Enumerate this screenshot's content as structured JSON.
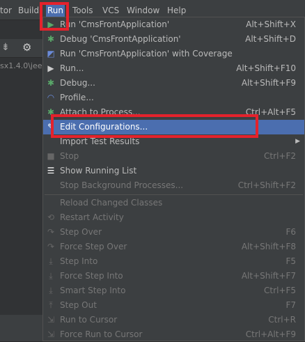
{
  "menubar": {
    "items": [
      "tor",
      "Build",
      "Run",
      "Tools",
      "VCS",
      "Window",
      "Help"
    ]
  },
  "left": {
    "path_text": "sx1.4.0\\jeec"
  },
  "run_menu": {
    "items": [
      {
        "label": "Run 'CmsFrontApplication'",
        "shortcut": "Alt+Shift+X",
        "icon": "run-icon"
      },
      {
        "label": "Debug 'CmsFrontApplication'",
        "shortcut": "Alt+Shift+D",
        "icon": "debug-icon"
      },
      {
        "label": "Run 'CmsFrontApplication' with Coverage",
        "shortcut": "",
        "icon": "coverage-icon"
      },
      {
        "label": "Run...",
        "shortcut": "Alt+Shift+F10",
        "icon": "run-triangle-icon"
      },
      {
        "label": "Debug...",
        "shortcut": "Alt+Shift+F9",
        "icon": "debug-icon"
      },
      {
        "label": "Profile...",
        "shortcut": "",
        "icon": "profile-icon"
      },
      {
        "label": "Attach to Process...",
        "shortcut": "Ctrl+Alt+F5",
        "icon": "attach-icon"
      },
      {
        "label": "Edit Configurations...",
        "shortcut": "",
        "icon": "edit-icon",
        "selected": true
      },
      {
        "label": "Import Test Results",
        "shortcut": "",
        "icon": "",
        "submenu": true
      },
      {
        "label": "Stop",
        "shortcut": "Ctrl+F2",
        "icon": "stop-icon",
        "disabled": true
      },
      {
        "label": "Show Running List",
        "shortcut": "",
        "icon": "list-icon"
      },
      {
        "label": "Stop Background Processes...",
        "shortcut": "Ctrl+Shift+F2",
        "icon": "",
        "disabled": true
      },
      {
        "label": "Reload Changed Classes",
        "shortcut": "",
        "icon": "",
        "disabled": true
      },
      {
        "label": "Restart Activity",
        "shortcut": "",
        "icon": "restart-icon",
        "disabled": true
      },
      {
        "label": "Step Over",
        "shortcut": "F6",
        "icon": "step-over-icon",
        "disabled": true
      },
      {
        "label": "Force Step Over",
        "shortcut": "Alt+Shift+F8",
        "icon": "force-step-over-icon",
        "disabled": true
      },
      {
        "label": "Step Into",
        "shortcut": "F5",
        "icon": "step-into-icon",
        "disabled": true
      },
      {
        "label": "Force Step Into",
        "shortcut": "Alt+Shift+F7",
        "icon": "force-step-into-icon",
        "disabled": true
      },
      {
        "label": "Smart Step Into",
        "shortcut": "Ctrl+F5",
        "icon": "smart-step-into-icon",
        "disabled": true
      },
      {
        "label": "Step Out",
        "shortcut": "F7",
        "icon": "step-out-icon",
        "disabled": true
      },
      {
        "label": "Run to Cursor",
        "shortcut": "Ctrl+R",
        "icon": "run-to-cursor-icon",
        "disabled": true
      },
      {
        "label": "Force Run to Cursor",
        "shortcut": "Ctrl+Alt+F9",
        "icon": "force-run-to-cursor-icon",
        "disabled": true
      }
    ]
  },
  "colors": {
    "menu_bg": "#3c3f41",
    "selection": "#4b6eaf",
    "highlight_box": "#e4222c",
    "run_green": "#59a869",
    "disabled_text": "#777777"
  }
}
